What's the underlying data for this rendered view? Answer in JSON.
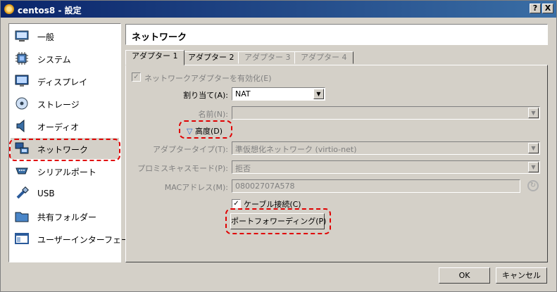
{
  "window": {
    "title": "centos8 - 設定",
    "help_button": "?",
    "close_button": "X"
  },
  "sidebar": {
    "items": [
      {
        "label": "一般",
        "icon": "general-icon"
      },
      {
        "label": "システム",
        "icon": "system-chip-icon"
      },
      {
        "label": "ディスプレイ",
        "icon": "display-icon"
      },
      {
        "label": "ストレージ",
        "icon": "storage-disk-icon"
      },
      {
        "label": "オーディオ",
        "icon": "audio-speaker-icon"
      },
      {
        "label": "ネットワーク",
        "icon": "network-icon"
      },
      {
        "label": "シリアルポート",
        "icon": "serial-port-icon"
      },
      {
        "label": "USB",
        "icon": "usb-icon"
      },
      {
        "label": "共有フォルダー",
        "icon": "shared-folder-icon"
      },
      {
        "label": "ユーザーインターフェース",
        "icon": "user-interface-icon"
      }
    ],
    "selected_index": 5
  },
  "section": {
    "title": "ネットワーク"
  },
  "tabs": [
    {
      "label": "アダプター 1",
      "state": "active"
    },
    {
      "label": "アダプター 2",
      "state": "enabled"
    },
    {
      "label": "アダプター 3",
      "state": "disabled"
    },
    {
      "label": "アダプター 4",
      "state": "disabled"
    }
  ],
  "adapter": {
    "enable_label": "ネットワークアダプターを有効化(E)",
    "enable_checked": true,
    "attached_label": "割り当て(A):",
    "attached_value": "NAT",
    "name_label": "名前(N):",
    "name_value": "",
    "advanced_label": "高度(D)",
    "adapter_type_label": "アダプタータイプ(T):",
    "adapter_type_value": "準仮想化ネットワーク (virtio-net)",
    "promiscuous_label": "プロミスキャスモード(P):",
    "promiscuous_value": "拒否",
    "mac_label": "MACアドレス(M):",
    "mac_value": "08002707A578",
    "cable_label": "ケーブル接続(C)",
    "cable_checked": true,
    "port_forwarding_label": "ポートフォワーディング(P)"
  },
  "footer": {
    "ok_label": "OK",
    "cancel_label": "キャンセル"
  },
  "colors": {
    "titlebar_start": "#0a246a",
    "titlebar_end": "#3a6ea5",
    "highlight_dash": "#e00000",
    "dialog_bg": "#d4d0c8"
  }
}
